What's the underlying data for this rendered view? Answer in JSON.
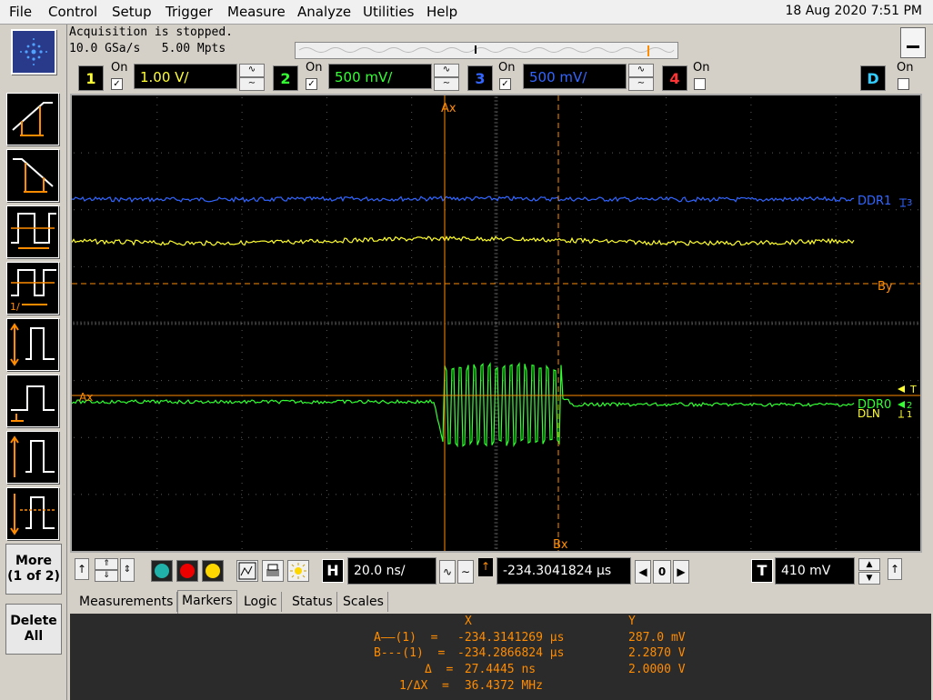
{
  "menu": [
    "File",
    "Control",
    "Setup",
    "Trigger",
    "Measure",
    "Analyze",
    "Utilities",
    "Help"
  ],
  "datetime": "18 Aug 2020  7:51 PM",
  "acquisition": {
    "status": "Acquisition is stopped.",
    "rate": "10.0 GSa/s   5.00 Mpts"
  },
  "channels": [
    {
      "num": "1",
      "on_label": "On",
      "checked": true,
      "scale": "1.00 V/",
      "color": "#ffff33"
    },
    {
      "num": "2",
      "on_label": "On",
      "checked": true,
      "scale": "500 mV/",
      "color": "#33ff33"
    },
    {
      "num": "3",
      "on_label": "On",
      "checked": true,
      "scale": "500 mV/",
      "color": "#3366ff"
    },
    {
      "num": "4",
      "on_label": "On",
      "checked": false,
      "scale": "",
      "color": "#ff3333"
    },
    {
      "num": "D",
      "on_label": "On",
      "checked": false,
      "scale": "",
      "color": "#33ccff"
    }
  ],
  "side_buttons": {
    "more": "More",
    "more_sub": "(1 of 2)",
    "delete": "Delete",
    "delete_sub": "All"
  },
  "trace_labels": {
    "ddr1": "DDR1",
    "ddr0": "DDR0",
    "ddr0_overlap": "DLN",
    "ax": "Ax",
    "bx": "Bx",
    "by": "By",
    "ax_left": "Ax",
    "t": "T",
    "ch3_marker": "3",
    "ch1_marker": "1",
    "ch2_marker": "2"
  },
  "timebase": {
    "scale": "20.0 ns/",
    "position": "-234.3041824 µs",
    "mode": "0"
  },
  "trigger": {
    "label": "T",
    "level": "410 mV"
  },
  "tabs": [
    "Measurements",
    "Markers",
    "Logic",
    "Status",
    "Scales"
  ],
  "active_tab": "Markers",
  "markers": {
    "header_x": "X",
    "header_y": "Y",
    "rows": [
      {
        "label": "A——(1)  =",
        "x": "-234.3141269 µs",
        "y": "287.0 mV"
      },
      {
        "label": "B---(1)  =",
        "x": "-234.2866824 µs",
        "y": "2.2870 V"
      },
      {
        "label": "Δ  =",
        "x": " 27.4445 ns",
        "y": "2.0000 V"
      },
      {
        "label": "1/ΔX  =",
        "x": " 36.4372 MHz",
        "y": ""
      }
    ]
  },
  "colors": {
    "marker_orange": "#ff8c00",
    "ch1": "#ffff33",
    "ch2": "#33ff33",
    "ch3": "#3366ff"
  }
}
